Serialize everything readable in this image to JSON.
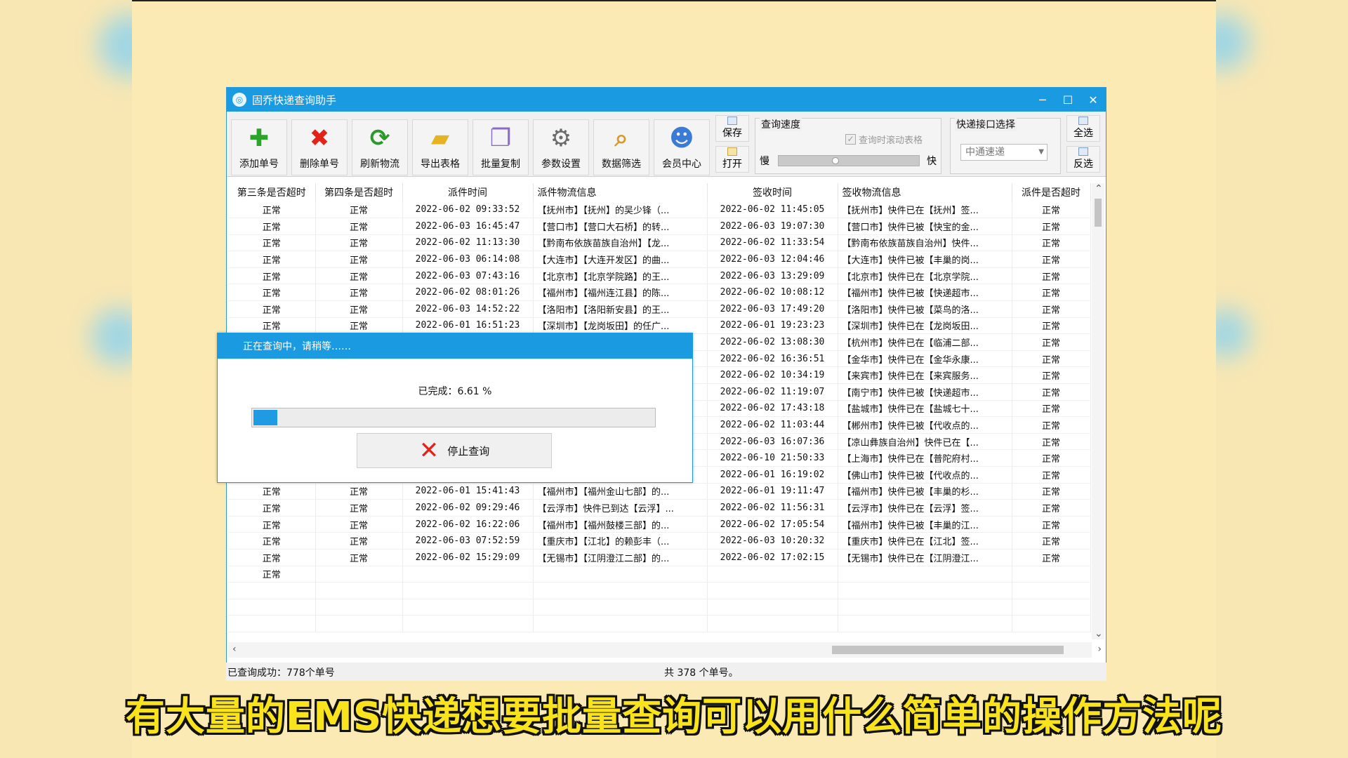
{
  "window": {
    "title": "固乔快递查询助手",
    "controls": {
      "minimize": "─",
      "maximize": "☐",
      "close": "✕"
    }
  },
  "toolbar": {
    "buttons": [
      {
        "label": "添加单号",
        "icon": "plus-icon",
        "glyph": "✚",
        "color": "#2aa52a"
      },
      {
        "label": "删除单号",
        "icon": "delete-x-icon",
        "glyph": "✖",
        "color": "#e2231a"
      },
      {
        "label": "刷新物流",
        "icon": "refresh-icon",
        "glyph": "⟳",
        "color": "#2b9a2b"
      },
      {
        "label": "导出表格",
        "icon": "export-folder-icon",
        "glyph": "▰",
        "color": "#e6b422"
      },
      {
        "label": "批量复制",
        "icon": "copy-icon",
        "glyph": "❐",
        "color": "#8a6cc8"
      },
      {
        "label": "参数设置",
        "icon": "gear-icon",
        "glyph": "⚙",
        "color": "#6b6b6b"
      },
      {
        "label": "数据筛选",
        "icon": "filter-search-icon",
        "glyph": "⌕",
        "color": "#d89b2b"
      },
      {
        "label": "会员中心",
        "icon": "members-icon",
        "glyph": "☻",
        "color": "#3a7bd5"
      }
    ],
    "save_label": "保存",
    "open_label": "打开",
    "speed": {
      "legend": "查询速度",
      "scroll_checkbox_label": "查询时滚动表格",
      "slow_label": "慢",
      "fast_label": "快"
    },
    "api": {
      "legend": "快递接口选择",
      "selected": "中通速递"
    },
    "select_all_label": "全选",
    "invert_label": "反选"
  },
  "table": {
    "columns": [
      "第三条是否超时",
      "第四条是否超时",
      "派件时间",
      "派件物流信息",
      "签收时间",
      "签收物流信息",
      "派件是否超时"
    ],
    "rows": [
      [
        "正常",
        "正常",
        "2022-06-02 09:33:52",
        "【抚州市】【抚州】的吴少锋（...",
        "2022-06-02 11:45:05",
        "【抚州市】快件已在【抚州】签...",
        "正常"
      ],
      [
        "正常",
        "正常",
        "2022-06-03 16:45:47",
        "【营口市】【营口大石桥】的转...",
        "2022-06-03 19:07:30",
        "【营口市】快件已被【快宝的金...",
        "正常"
      ],
      [
        "正常",
        "正常",
        "2022-06-02 11:13:30",
        "【黔南布依族苗族自治州】【龙...",
        "2022-06-02 11:33:54",
        "【黔南布依族苗族自治州】快件...",
        "正常"
      ],
      [
        "正常",
        "正常",
        "2022-06-03 06:14:08",
        "【大连市】【大连开发区】的曲...",
        "2022-06-03 12:04:46",
        "【大连市】快件已被【丰巢的岗...",
        "正常"
      ],
      [
        "正常",
        "正常",
        "2022-06-03 07:43:16",
        "【北京市】【北京学院路】的王...",
        "2022-06-03 13:29:09",
        "【北京市】快件已在【北京学院...",
        "正常"
      ],
      [
        "正常",
        "正常",
        "2022-06-02 08:01:26",
        "【福州市】【福州连江县】的陈...",
        "2022-06-02 10:08:12",
        "【福州市】快件已被【快递超市...",
        "正常"
      ],
      [
        "正常",
        "正常",
        "2022-06-03 14:52:22",
        "【洛阳市】【洛阳新安县】的王...",
        "2022-06-03 17:49:20",
        "【洛阳市】快件已被【菜鸟的洛...",
        "正常"
      ],
      [
        "正常",
        "正常",
        "2022-06-01 16:51:23",
        "【深圳市】【龙岗坂田】的任广...",
        "2022-06-01 19:23:23",
        "【深圳市】快件已在【龙岗坂田...",
        "正常"
      ],
      [
        "",
        "",
        "",
        "",
        "2022-06-02 13:08:30",
        "【杭州市】快件已在【临浦二部...",
        "正常"
      ],
      [
        "",
        "",
        "",
        "",
        "2022-06-02 16:36:51",
        "【金华市】快件已在【金华永康...",
        "正常"
      ],
      [
        "",
        "",
        "",
        "",
        "2022-06-02 10:34:19",
        "【来宾市】快件已在【来宾服务...",
        "正常"
      ],
      [
        "",
        "",
        "",
        "",
        "2022-06-02 11:19:07",
        "【南宁市】快件已被【快递超市...",
        "正常"
      ],
      [
        "",
        "",
        "",
        "",
        "2022-06-02 17:43:18",
        "【盐城市】快件已在【盐城七十...",
        "正常"
      ],
      [
        "",
        "",
        "",
        "",
        "2022-06-02 11:03:44",
        "【郴州市】快件已被【代收点的...",
        "正常"
      ],
      [
        "",
        "",
        "",
        "",
        "2022-06-03 16:07:36",
        "【凉山彝族自治州】快件已在【...",
        "正常"
      ],
      [
        "",
        "",
        "",
        "",
        "2022-06-10 21:50:33",
        "【上海市】快件已在【普陀府村...",
        "正常"
      ],
      [
        "",
        "",
        "",
        "",
        "2022-06-01 16:19:02",
        "【佛山市】快件已被【代收点的...",
        "正常"
      ],
      [
        "正常",
        "正常",
        "2022-06-01 15:41:43",
        "【福州市】【福州金山七部】的...",
        "2022-06-01 19:11:47",
        "【福州市】快件已被【丰巢的杉...",
        "正常"
      ],
      [
        "正常",
        "正常",
        "2022-06-02 09:29:46",
        "【云浮市】快件已到达【云浮】...",
        "2022-06-02 11:56:31",
        "【云浮市】快件已在【云浮】签...",
        "正常"
      ],
      [
        "正常",
        "正常",
        "2022-06-02 16:22:06",
        "【福州市】【福州鼓楼三部】的...",
        "2022-06-02 17:05:54",
        "【福州市】快件已被【丰巢的江...",
        "正常"
      ],
      [
        "正常",
        "正常",
        "2022-06-03 07:52:59",
        "【重庆市】【江北】的赖彭丰（...",
        "2022-06-03 10:20:32",
        "【重庆市】快件已在【江北】签...",
        "正常"
      ],
      [
        "正常",
        "正常",
        "2022-06-02 15:29:09",
        "【无锡市】【江阴澄江二部】的...",
        "2022-06-02 17:02:15",
        "【无锡市】快件已在【江阴澄江...",
        "正常"
      ],
      [
        "正常",
        "",
        "",
        "",
        "",
        "",
        ""
      ],
      [
        "",
        "",
        "",
        "",
        "",
        "",
        ""
      ],
      [
        "",
        "",
        "",
        "",
        "",
        "",
        ""
      ],
      [
        "",
        "",
        "",
        "",
        "",
        "",
        ""
      ]
    ]
  },
  "status": {
    "left": "已查询成功：778个单号",
    "right": "共 378 个单号。"
  },
  "dialog": {
    "title": "正在查询中，请稍等……",
    "progress_text": "已完成：6.61 %",
    "progress": 0.0661,
    "stop_label": "停止查询"
  },
  "subtitle": "有大量的EMS快递想要批量查询可以用什么简单的操作方法呢"
}
